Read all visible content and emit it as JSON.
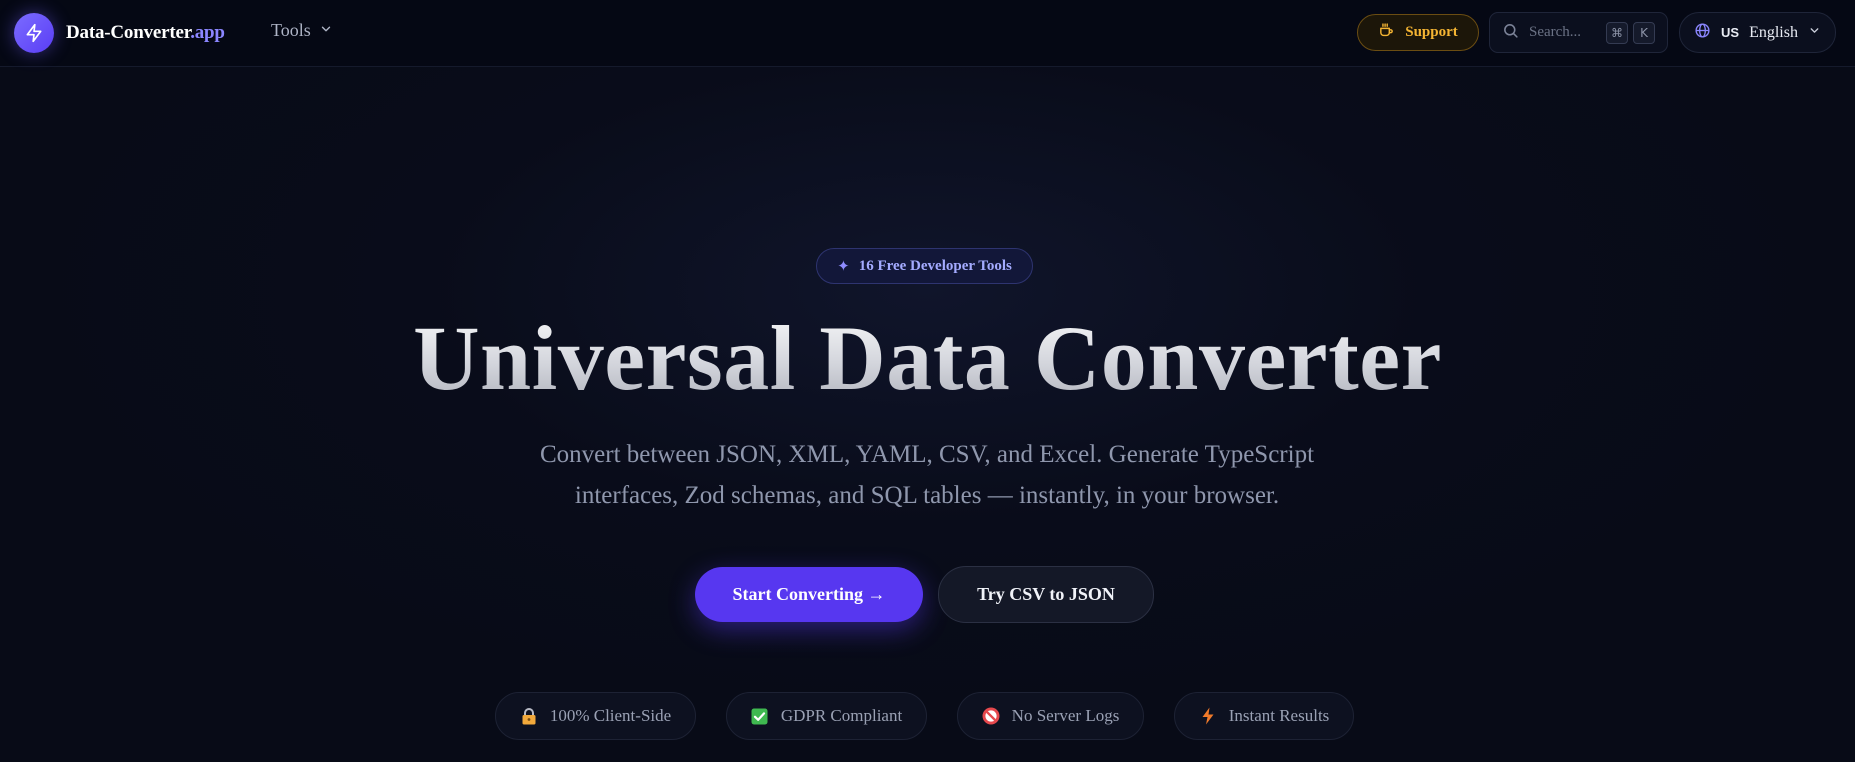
{
  "header": {
    "brand_name": "Data-Converter",
    "brand_suffix": ".app",
    "tools_label": "Tools",
    "support_label": "Support",
    "search": {
      "placeholder": "Search...",
      "shortcut_mod": "⌘",
      "shortcut_key": "K"
    },
    "language": {
      "code": "US",
      "label": "English"
    }
  },
  "hero": {
    "badge": "16 Free Developer Tools",
    "title": "Universal Data Converter",
    "subtitle_line1": "Convert between JSON, XML, YAML, CSV, and Excel. Generate TypeScript",
    "subtitle_line2": "interfaces, Zod schemas, and SQL tables — instantly, in your browser.",
    "primary_cta": "Start Converting →",
    "secondary_cta": "Try CSV to JSON"
  },
  "features": [
    {
      "label": "100% Client-Side",
      "icon": "lock-icon"
    },
    {
      "label": "GDPR Compliant",
      "icon": "check-box-icon"
    },
    {
      "label": "No Server Logs",
      "icon": "prohibited-icon"
    },
    {
      "label": "Instant Results",
      "icon": "lightning-icon"
    }
  ],
  "colors": {
    "background": "#080b17",
    "accent": "#5737f0",
    "support": "#f5b533",
    "badge_text": "#a4abff"
  }
}
